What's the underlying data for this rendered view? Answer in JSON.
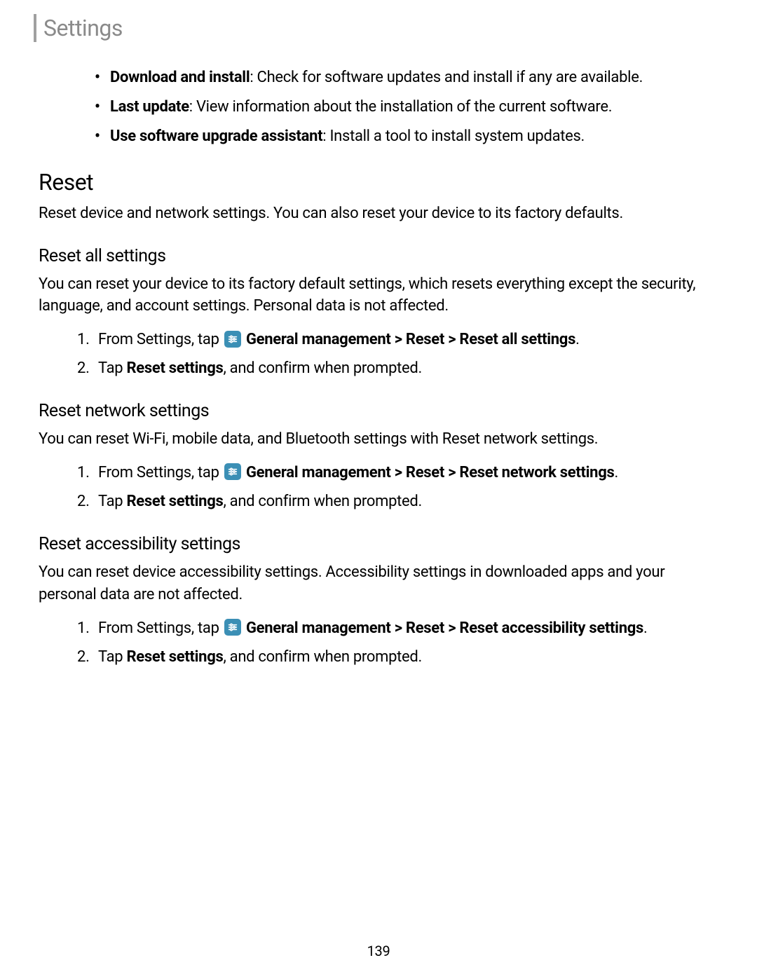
{
  "header": {
    "title": "Settings"
  },
  "bullets": [
    {
      "label": "Download and install",
      "text": ": Check for software updates and install if any are available."
    },
    {
      "label": "Last update",
      "text": ": View information about the installation of the current software."
    },
    {
      "label": "Use software upgrade assistant",
      "text": ": Install a tool to install system updates."
    }
  ],
  "reset": {
    "heading": "Reset",
    "desc": "Reset device and network settings. You can also reset your device to its factory defaults."
  },
  "reset_all": {
    "heading": "Reset all settings",
    "desc": "You can reset your device to its factory default settings, which resets everything except the security, language, and account settings. Personal data is not affected.",
    "step1_prefix": "From Settings, tap ",
    "step1_bold": "General management > Reset > Reset all settings",
    "step1_suffix": ".",
    "step2_prefix": "Tap ",
    "step2_bold": "Reset settings",
    "step2_suffix": ", and confirm when prompted."
  },
  "reset_network": {
    "heading": "Reset network settings",
    "desc": "You can reset Wi-Fi, mobile data, and Bluetooth settings with Reset network settings.",
    "step1_prefix": "From Settings, tap ",
    "step1_bold": "General management > Reset > Reset network settings",
    "step1_suffix": ".",
    "step2_prefix": "Tap ",
    "step2_bold": "Reset settings",
    "step2_suffix": ", and confirm when prompted."
  },
  "reset_accessibility": {
    "heading": "Reset accessibility settings",
    "desc": "You can reset device accessibility settings. Accessibility settings in downloaded apps and your personal data are not affected.",
    "step1_prefix": "From Settings, tap ",
    "step1_bold": "General management > Reset > Reset accessibility settings",
    "step1_suffix": ".",
    "step2_prefix": "Tap ",
    "step2_bold": "Reset settings",
    "step2_suffix": ", and confirm when prompted."
  },
  "numbers": {
    "one": "1.",
    "two": "2."
  },
  "page_number": "139"
}
